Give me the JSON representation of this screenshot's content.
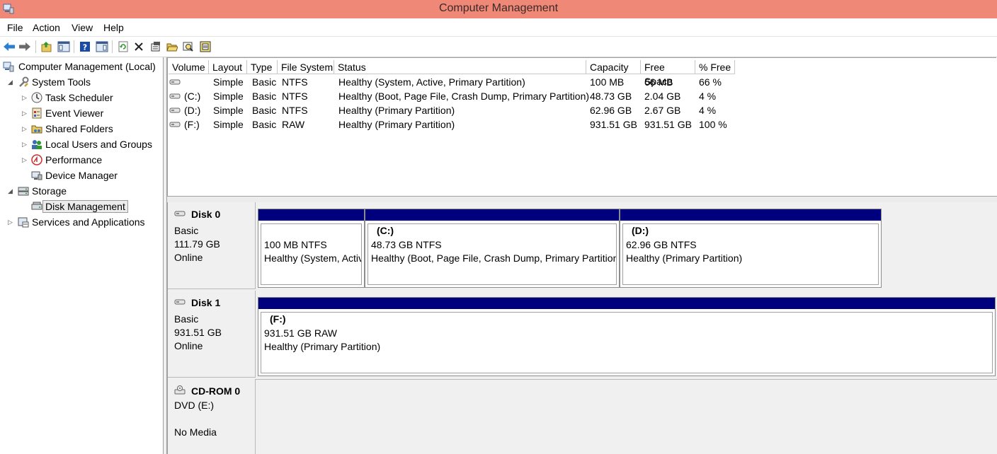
{
  "window": {
    "title": "Computer Management"
  },
  "menu": {
    "items": [
      "File",
      "Action",
      "View",
      "Help"
    ]
  },
  "toolbar": {
    "buttons": [
      "back-icon",
      "forward-icon",
      "up-icon",
      "show-hide-console-tree-icon",
      "help-icon",
      "show-action-pane-icon",
      "refresh-icon",
      "delete-icon",
      "properties-icon",
      "open-icon",
      "search-icon",
      "disk-settings-icon"
    ]
  },
  "tree": {
    "root": "Computer Management (Local)",
    "system_tools": "System Tools",
    "task_scheduler": "Task Scheduler",
    "event_viewer": "Event Viewer",
    "shared_folders": "Shared Folders",
    "local_users": "Local Users and Groups",
    "performance": "Performance",
    "device_manager": "Device Manager",
    "storage": "Storage",
    "disk_management": "Disk Management",
    "services": "Services and Applications"
  },
  "volume_table": {
    "columns": [
      "Volume",
      "Layout",
      "Type",
      "File System",
      "Status",
      "Capacity",
      "Free Space",
      "% Free"
    ],
    "rows": [
      {
        "volume": "",
        "layout": "Simple",
        "type": "Basic",
        "fs": "NTFS",
        "status": "Healthy (System, Active, Primary Partition)",
        "capacity": "100 MB",
        "free": "66 MB",
        "pct": "66 %"
      },
      {
        "volume": "(C:)",
        "layout": "Simple",
        "type": "Basic",
        "fs": "NTFS",
        "status": "Healthy (Boot, Page File, Crash Dump, Primary Partition)",
        "capacity": "48.73 GB",
        "free": "2.04 GB",
        "pct": "4 %"
      },
      {
        "volume": "(D:)",
        "layout": "Simple",
        "type": "Basic",
        "fs": "NTFS",
        "status": "Healthy (Primary Partition)",
        "capacity": "62.96 GB",
        "free": "2.67 GB",
        "pct": "4 %"
      },
      {
        "volume": "(F:)",
        "layout": "Simple",
        "type": "Basic",
        "fs": "RAW",
        "status": "Healthy (Primary Partition)",
        "capacity": "931.51 GB",
        "free": "931.51 GB",
        "pct": "100 %"
      }
    ]
  },
  "disks": {
    "disk0": {
      "name": "Disk 0",
      "type": "Basic",
      "size": "111.79 GB",
      "state": "Online",
      "parts": [
        {
          "label": "",
          "size": "100 MB NTFS",
          "status": "Healthy (System, Activ"
        },
        {
          "label": "(C:)",
          "size": "48.73 GB NTFS",
          "status": "Healthy (Boot, Page File, Crash Dump, Primary Partition)"
        },
        {
          "label": "(D:)",
          "size": "62.96 GB NTFS",
          "status": "Healthy (Primary Partition)"
        }
      ]
    },
    "disk1": {
      "name": "Disk 1",
      "type": "Basic",
      "size": "931.51 GB",
      "state": "Online",
      "parts": [
        {
          "label": "(F:)",
          "size": "931.51 GB RAW",
          "status": "Healthy (Primary Partition)"
        }
      ]
    },
    "cdrom0": {
      "name": "CD-ROM 0",
      "type": "DVD (E:)",
      "state": "No Media"
    }
  },
  "colors": {
    "titlebar": "#f08878",
    "partition_bar": "#00007f"
  }
}
